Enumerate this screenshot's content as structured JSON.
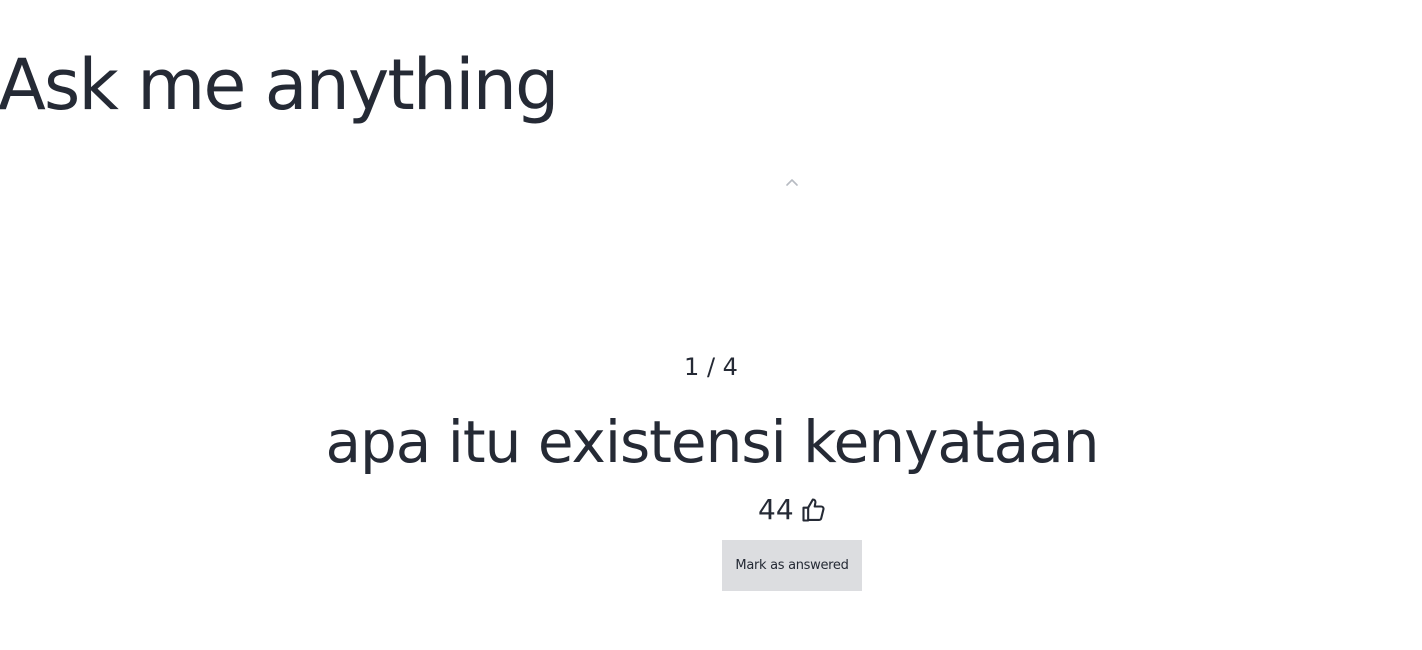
{
  "page": {
    "title": "Ask me anything"
  },
  "navigation": {
    "prev_icon": "chevron-up-icon"
  },
  "question": {
    "counter": "1 / 4",
    "text": "apa itu existensi kenyataan",
    "votes": "44",
    "vote_icon": "thumbs-up-icon"
  },
  "actions": {
    "mark_answered_label": "Mark as answered"
  },
  "colors": {
    "text": "#252a35",
    "button_bg": "#dcdde0",
    "chevron": "#b7bbc2",
    "background": "#ffffff"
  }
}
